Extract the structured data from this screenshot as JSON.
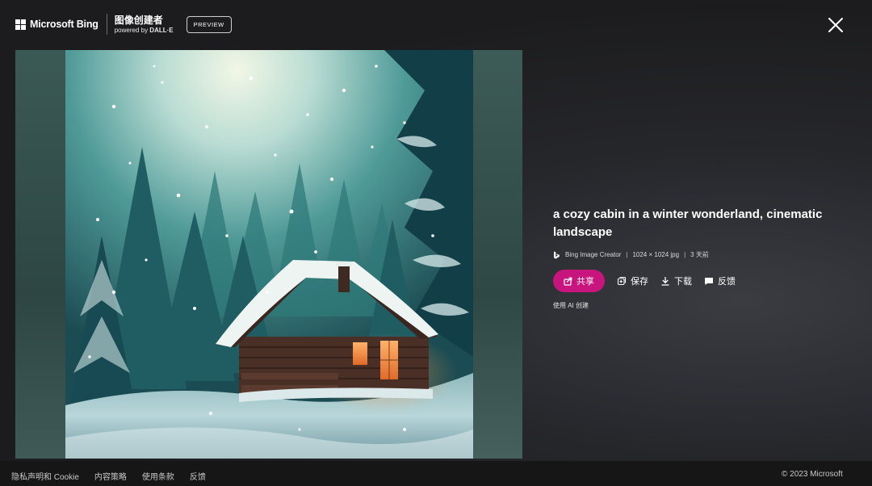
{
  "header": {
    "brand_name": "Microsoft Bing",
    "product_title": "图像创建者",
    "powered_by_prefix": "powered by ",
    "powered_by_name": "DALL·E",
    "badge": "PREVIEW"
  },
  "image": {
    "alt": "a cozy cabin in a winter wonderland, cinematic landscape"
  },
  "details": {
    "prompt": "a cozy cabin in a winter wonderland, cinematic landscape",
    "source": "Bing Image Creator",
    "size": "1024 × 1024 jpg",
    "time": "3 天前",
    "separator": "|",
    "ai_note": "使用 AI 创建"
  },
  "actions": {
    "share": "共享",
    "save": "保存",
    "download": "下载",
    "feedback": "反馈"
  },
  "footer": {
    "links": [
      "隐私声明和 Cookie",
      "内容策略",
      "使用条款",
      "反馈"
    ],
    "copyright": "© 2023 Microsoft"
  },
  "colors": {
    "accent": "#c8157e",
    "background": "#1c1c1e",
    "footer": "#161617"
  }
}
